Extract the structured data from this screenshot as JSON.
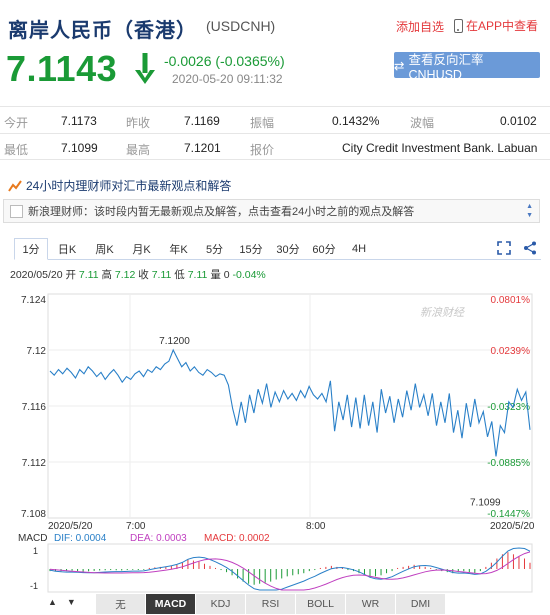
{
  "header": {
    "title": "离岸人民币（香港）",
    "symbol": "(USDCNH)",
    "add_watch": "添加自选",
    "app_view": "在APP中查看"
  },
  "quote": {
    "price": "7.1143",
    "change": "-0.0026 (-0.0365%)",
    "timestamp": "2020-05-20 09:11:32",
    "reverse_label": "查看反向汇率 CNHUSD"
  },
  "table": {
    "row1": [
      {
        "label": "今开",
        "value": "7.1173"
      },
      {
        "label": "昨收",
        "value": "7.1169"
      },
      {
        "label": "振幅",
        "value": "0.1432%"
      },
      {
        "label": "波幅",
        "value": "0.0102"
      }
    ],
    "row2": [
      {
        "label": "最低",
        "value": "7.1099"
      },
      {
        "label": "最高",
        "value": "7.1201"
      },
      {
        "label": "报价",
        "value": "City Credit Investment Bank. Labuan"
      }
    ]
  },
  "news": {
    "heading": "24小时内理财师对汇市最新观点和解答",
    "message": "新浪理财师：该时段内暂无最新观点及解答，点击查看24小时之前的观点及解答"
  },
  "tabs": [
    "1分",
    "日K",
    "周K",
    "月K",
    "年K",
    "5分",
    "15分",
    "30分",
    "60分",
    "4H"
  ],
  "ohlc": {
    "date": "2020/05/20",
    "open_label": "开",
    "open": "7.11",
    "high_label": "高",
    "high": "7.12",
    "close_label": "收",
    "close": "7.11",
    "low_label": "低",
    "low": "7.11",
    "vol_label": "量",
    "vol": "0",
    "pct": "-0.04%"
  },
  "chart": {
    "watermark": "新浪财经",
    "high_marker": "7.1200",
    "low_marker": "7.1099",
    "date_left": "2020/5/20",
    "date_right": "2020/5/20",
    "time_labels": [
      "7:00",
      "8:00"
    ],
    "y_labels": [
      "7.124",
      "7.12",
      "7.116",
      "7.112",
      "7.108"
    ],
    "pct_labels": [
      "0.0801%",
      "0.0239%",
      "-0.0323%",
      "-0.0885%",
      "-0.1447%"
    ],
    "up_color": "#e4393c",
    "down_color": "#1a9a36",
    "line_color": "#2a80c8"
  },
  "macd": {
    "name": "MACD",
    "dif_label": "DIF: 0.0004",
    "dea_label": "DEA: 0.0003",
    "macd_label": "MACD: 0.0002",
    "scale_top": "1",
    "scale_bottom": "-1"
  },
  "indicators": [
    "无",
    "MACD",
    "KDJ",
    "RSI",
    "BOLL",
    "WR",
    "DMI"
  ],
  "chart_data": {
    "type": "line",
    "title": "",
    "y_ticks": [
      7.124,
      7.12,
      7.116,
      7.112,
      7.108
    ],
    "ylim": [
      7.108,
      7.124
    ],
    "pct_ticks": [
      "0.0801%",
      "0.0239%",
      "-0.0323%",
      "-0.0885%",
      "-0.1447%"
    ],
    "x_ticks": [
      "2020/5/20",
      "7:00",
      "8:00",
      "2020/5/20"
    ],
    "series": [
      {
        "values": [
          7.1185,
          7.1182,
          7.1186,
          7.1183,
          7.1187,
          7.1184,
          7.118,
          7.1186,
          7.1183,
          7.1188,
          7.1185,
          7.1181,
          7.1184,
          7.1179,
          7.1183,
          7.1186,
          7.1182,
          7.1177,
          7.1181,
          7.1179,
          7.1183,
          7.1185,
          7.1181,
          7.1186,
          7.1184,
          7.1188,
          7.1186,
          7.119,
          7.1192,
          7.12,
          7.1194,
          7.1188,
          7.1191,
          7.1185,
          7.1188,
          7.1184,
          7.1182,
          7.1186,
          7.1184,
          7.1181,
          7.1183,
          7.1182,
          7.1175,
          7.1158,
          7.1146,
          7.1163,
          7.1148,
          7.1168,
          7.1155,
          7.1172,
          7.1162,
          7.1176,
          7.1159,
          7.117,
          7.1163,
          7.1171,
          7.1165,
          7.1169,
          7.1164,
          7.1171,
          7.1166,
          7.1174,
          7.1168,
          7.1165,
          7.1169,
          7.1163,
          7.1178,
          7.1142,
          7.1163,
          7.115,
          7.1168,
          7.1145,
          7.1166,
          7.1144,
          7.1168,
          7.1146,
          7.1163,
          7.1141,
          7.1172,
          7.1155,
          7.1167,
          7.1148,
          7.1165,
          7.1152,
          7.1171,
          7.1157,
          7.1176,
          7.1159,
          7.1168,
          7.1153,
          7.1169,
          7.1146,
          7.1163,
          7.1148,
          7.1169,
          7.1141,
          7.1157,
          7.1137,
          7.1162,
          7.1145,
          7.1165,
          7.1148,
          7.1156,
          7.1138,
          7.1149,
          7.1124,
          7.1146,
          7.1141,
          7.1163,
          7.1159,
          7.1172,
          7.1164,
          7.117,
          7.1143
        ]
      }
    ],
    "high_point": 7.12,
    "low_point": 7.1099,
    "macd": {
      "dif": 0.0004,
      "dea": 0.0003,
      "macd": 0.0002,
      "range": [
        -1,
        1
      ],
      "hist": [
        -0.1,
        -0.12,
        -0.11,
        -0.1,
        -0.08,
        -0.1,
        -0.12,
        -0.11,
        -0.09,
        -0.07,
        -0.06,
        -0.05,
        -0.06,
        -0.07,
        -0.05,
        -0.04,
        -0.05,
        -0.04,
        0.05,
        0.08,
        0.1,
        0.12,
        0.15,
        0.2,
        0.3,
        0.45,
        0.4,
        0.35,
        0.25,
        0.15,
        0.05,
        -0.05,
        -0.15,
        -0.3,
        -0.45,
        -0.6,
        -0.7,
        -0.75,
        -0.7,
        -0.65,
        -0.6,
        -0.5,
        -0.45,
        -0.35,
        -0.3,
        -0.25,
        -0.2,
        -0.1,
        -0.05,
        0.05,
        0.1,
        0.15,
        0.1,
        0.05,
        -0.05,
        -0.1,
        -0.2,
        -0.3,
        -0.4,
        -0.35,
        -0.3,
        -0.2,
        -0.1,
        0.05,
        0.1,
        0.15,
        0.2,
        0.15,
        0.1,
        0.05,
        -0.05,
        -0.1,
        -0.15,
        -0.2,
        -0.15,
        -0.1,
        -0.15,
        -0.2,
        -0.1,
        0.1,
        0.3,
        0.5,
        0.7,
        0.8,
        0.7,
        0.6,
        0.5,
        0.3
      ]
    }
  }
}
